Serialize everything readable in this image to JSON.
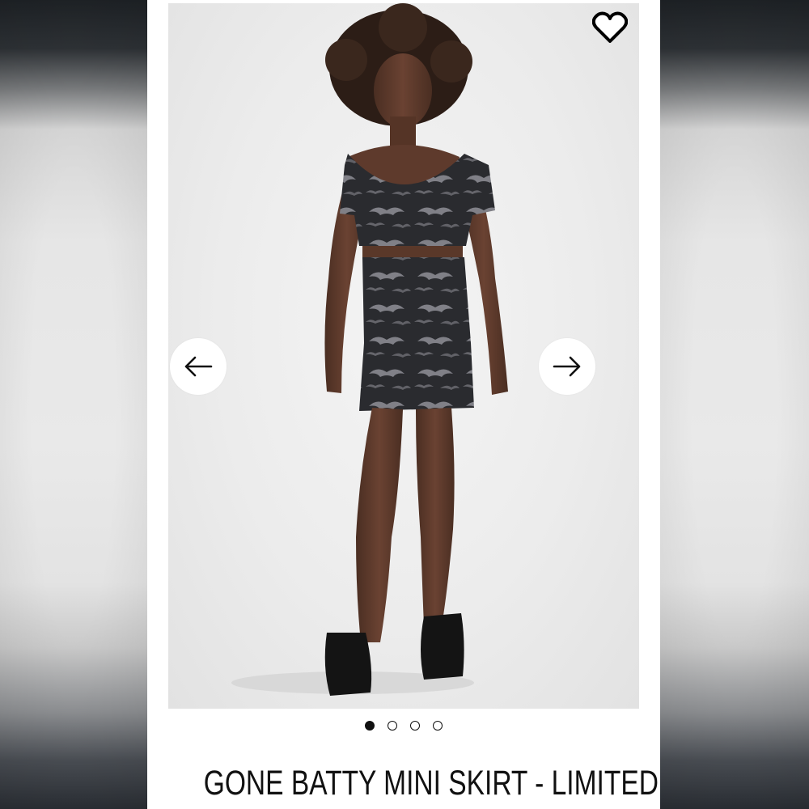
{
  "product": {
    "title": "GONE BATTY MINI SKIRT - LIMITED",
    "image_alt": "Model wearing bat print crop top and mini skirt"
  },
  "gallery": {
    "image_count": 4,
    "active_index": 0,
    "dots": [
      "image-1",
      "image-2",
      "image-3",
      "image-4"
    ]
  },
  "icons": {
    "favorite": "heart-outline-icon",
    "prev": "arrow-left-icon",
    "next": "arrow-right-icon"
  },
  "colors": {
    "card_bg": "#ffffff",
    "text": "#111111",
    "photo_bg": "#ececec",
    "garment": "#2b2c30"
  }
}
